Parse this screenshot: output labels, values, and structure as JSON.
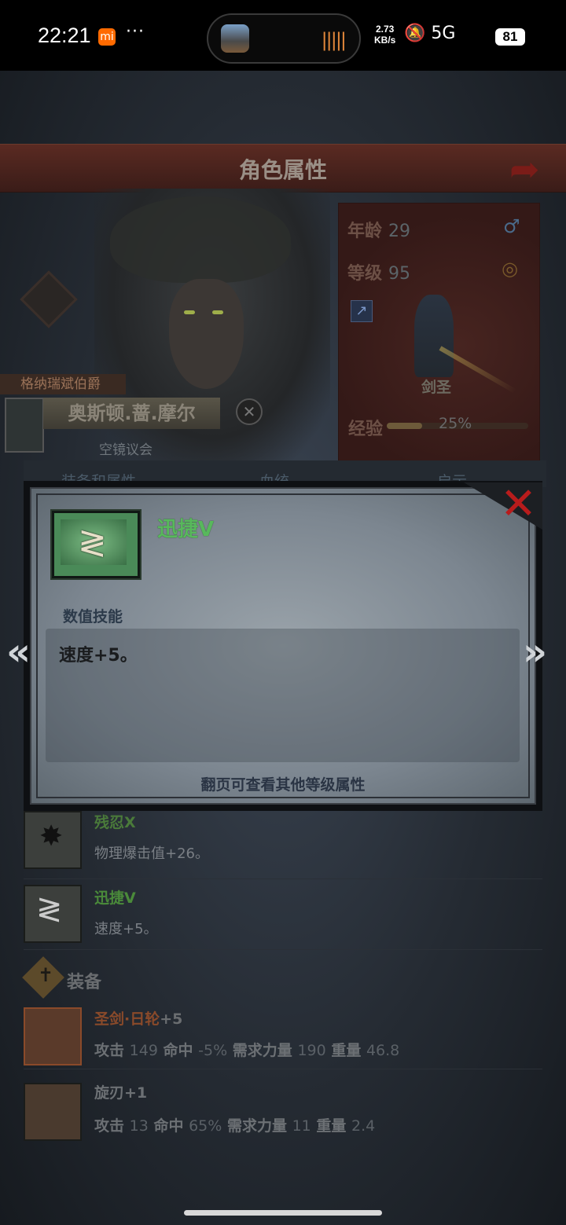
{
  "status_bar": {
    "time": "22:21",
    "app_badge": "mi",
    "more": "···",
    "net_speed_value": "2.73",
    "net_speed_unit": "KB/s",
    "signal_icons": "🔕 5G",
    "battery": "81"
  },
  "header": {
    "title": "角色属性"
  },
  "character": {
    "rank_label": "格纳瑞斌伯爵",
    "name": "奥斯顿.蔷.摩尔",
    "faction": "空镜议会"
  },
  "stats": {
    "age_label": "年龄",
    "age_value": "29",
    "level_label": "等级",
    "level_value": "95",
    "class_name": "剑圣",
    "exp_label": "经验",
    "exp_percent": "25%",
    "exp_fraction": 0.25
  },
  "tabs": [
    "装备和属性",
    "血统",
    "启示"
  ],
  "skills_list": [
    {
      "name": "残忍X",
      "description": "物理爆击值+26。",
      "color": "#4a7a3a"
    },
    {
      "name": "迅捷V",
      "description": "速度+5。",
      "color": "#4a8a3a"
    }
  ],
  "equipment": {
    "title": "装备",
    "items": [
      {
        "name": "圣剑·日轮",
        "plus": "+5",
        "atk_label": "攻击",
        "atk": "149",
        "hit_label": "命中",
        "hit": "-5%",
        "str_label": "需求力量",
        "str": "190",
        "weight_label": "重量",
        "weight": "46.8",
        "name_color": "#8a4a2a"
      },
      {
        "name": "旋刃",
        "plus": "+1",
        "atk_label": "攻击",
        "atk": "13",
        "hit_label": "命中",
        "hit": "65%",
        "str_label": "需求力量",
        "str": "11",
        "weight_label": "重量",
        "weight": "2.4",
        "name_color": "#6c7074"
      }
    ]
  },
  "popup": {
    "skill_name": "迅捷V",
    "skill_type": "数值技能",
    "description": "速度+5。",
    "hint": "翻页可查看其他等级属性",
    "prev": "«",
    "next": "»",
    "close": "✕"
  },
  "colors": {
    "skill_green": "#58b85c",
    "close_red": "#b81c1c"
  }
}
